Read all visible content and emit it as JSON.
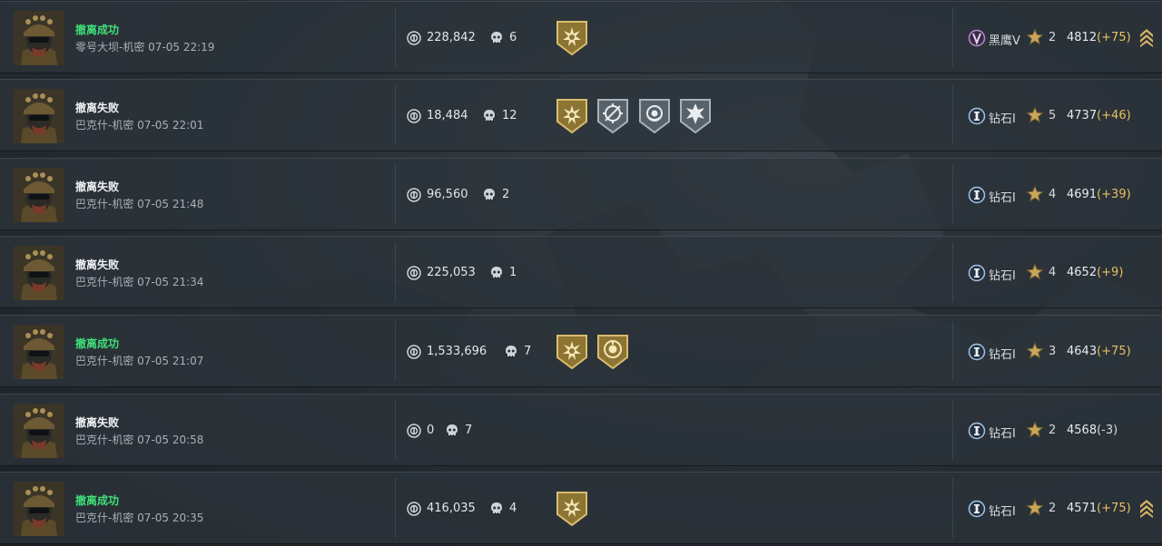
{
  "theme": {
    "success_color": "#3fe07a",
    "fail_color": "#f1f3f5",
    "delta_color": "#e8c060",
    "row_bg": "#2c343c"
  },
  "icons": {
    "currency": "coin-icon",
    "kills": "skull-icon",
    "rank": "rank-emblem-icon",
    "star": "star-icon",
    "streak": "chevrons-up-icon"
  },
  "matches": [
    {
      "status": "撤离成功",
      "status_type": "success",
      "map": "零号大坝-机密",
      "time": "07-05 22:19",
      "value": "228,842",
      "kills": "6",
      "badges": [
        "gold-sun-badge-icon"
      ],
      "rank_name": "黑鹰V",
      "rank_type": "blackhawk",
      "stars": "2",
      "score": "4812",
      "delta": "(+75)",
      "delta_type": "up",
      "streak": true
    },
    {
      "status": "撤离失败",
      "status_type": "fail",
      "map": "巴克什-机密",
      "time": "07-05 22:01",
      "value": "18,484",
      "kills": "12",
      "badges": [
        "gold-sun-badge-icon",
        "crosshair-badge-icon",
        "target-badge-icon",
        "burst-badge-icon"
      ],
      "rank_name": "钻石I",
      "rank_type": "diamond",
      "stars": "5",
      "score": "4737",
      "delta": "(+46)",
      "delta_type": "up",
      "streak": false
    },
    {
      "status": "撤离失败",
      "status_type": "fail",
      "map": "巴克什-机密",
      "time": "07-05 21:48",
      "value": "96,560",
      "kills": "2",
      "badges": [],
      "rank_name": "钻石I",
      "rank_type": "diamond",
      "stars": "4",
      "score": "4691",
      "delta": "(+39)",
      "delta_type": "up",
      "streak": false
    },
    {
      "status": "撤离失败",
      "status_type": "fail",
      "map": "巴克什-机密",
      "time": "07-05 21:34",
      "value": "225,053",
      "kills": "1",
      "badges": [],
      "rank_name": "钻石I",
      "rank_type": "diamond",
      "stars": "4",
      "score": "4652",
      "delta": "(+9)",
      "delta_type": "up",
      "streak": false
    },
    {
      "status": "撤离成功",
      "status_type": "success",
      "map": "巴克什-机密",
      "time": "07-05 21:07",
      "value": "1,533,696",
      "kills": "7",
      "badges": [
        "gold-sun-badge-icon",
        "gold-coin-badge-icon"
      ],
      "rank_name": "钻石I",
      "rank_type": "diamond",
      "stars": "3",
      "score": "4643",
      "delta": "(+75)",
      "delta_type": "up",
      "streak": false
    },
    {
      "status": "撤离失败",
      "status_type": "fail",
      "map": "巴克什-机密",
      "time": "07-05 20:58",
      "value": "0",
      "kills": "7",
      "badges": [],
      "rank_name": "钻石I",
      "rank_type": "diamond",
      "stars": "2",
      "score": "4568",
      "delta": "(-3)",
      "delta_type": "down",
      "streak": false
    },
    {
      "status": "撤离成功",
      "status_type": "success",
      "map": "巴克什-机密",
      "time": "07-05 20:35",
      "value": "416,035",
      "kills": "4",
      "badges": [
        "gold-sun-badge-icon"
      ],
      "rank_name": "钻石I",
      "rank_type": "diamond",
      "stars": "2",
      "score": "4571",
      "delta": "(+75)",
      "delta_type": "up",
      "streak": true
    }
  ]
}
